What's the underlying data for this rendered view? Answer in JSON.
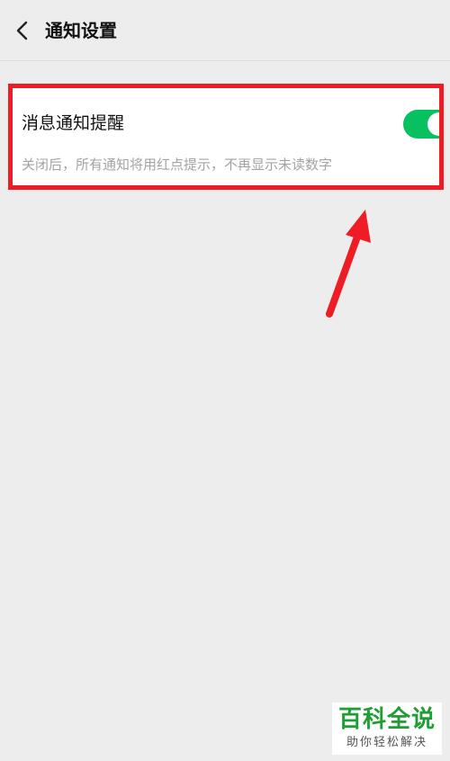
{
  "header": {
    "back_icon": "chevron-left-icon",
    "title": "通知设置"
  },
  "setting": {
    "label": "消息通知提醒",
    "description": "关闭后，所有通知将用红点提示，不再显示未读数字",
    "toggle_state": "on",
    "toggle_color": "#07c160"
  },
  "annotation": {
    "highlight_color": "#ee1c25",
    "arrow_icon": "arrow-up-icon"
  },
  "watermark": {
    "title": "百科全说",
    "subtitle": "助你轻松解决",
    "title_color": "#1f9e33"
  }
}
